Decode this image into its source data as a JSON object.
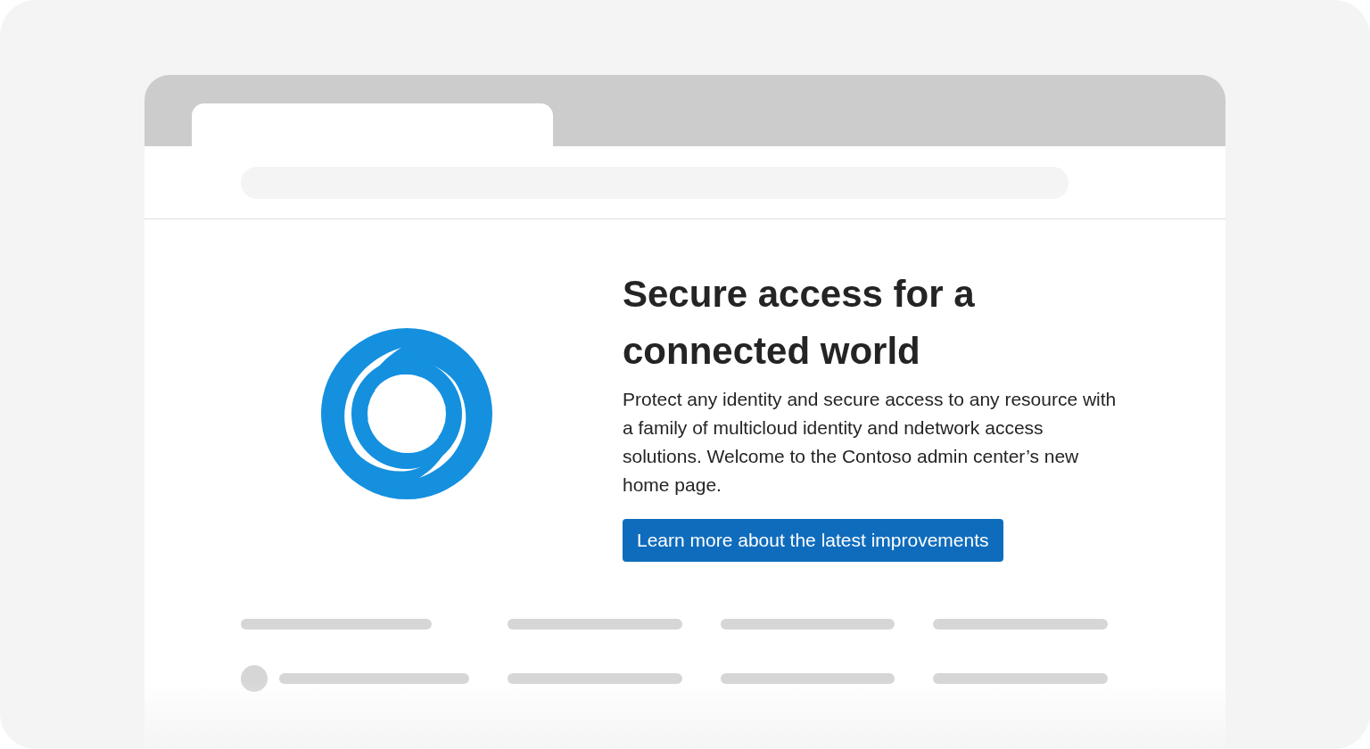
{
  "hero": {
    "heading": "Secure access for a connected world",
    "description": "Protect any identity and secure access to any resource with a family of multicloud identity and ndetwork access solutions. Welcome to the Contoso admin center’s new home page.",
    "button": "Learn more about the latest improvements"
  }
}
